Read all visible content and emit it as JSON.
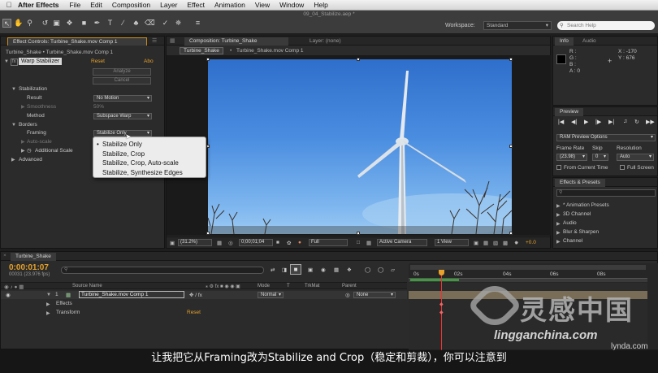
{
  "menubar": {
    "apple": "",
    "app": "After Effects",
    "items": [
      "File",
      "Edit",
      "Composition",
      "Layer",
      "Effect",
      "Animation",
      "View",
      "Window",
      "Help"
    ]
  },
  "toolbar": {
    "file_title": "09_04_Stabilize.aep *",
    "workspace_label": "Workspace:",
    "workspace_value": "Standard",
    "search_placeholder": "Search Help"
  },
  "effect_controls": {
    "tab": "Effect Controls: Turbine_Shake.mov Comp 1",
    "breadcrumb": "Turbine_Shake • Turbine_Shake.mov Comp 1",
    "fx_badge": "fx",
    "effect_name": "Warp Stabilizer",
    "reset": "Reset",
    "about": "Abo",
    "analyze": "Analyze",
    "cancel": "Cancel",
    "stabilization": "Stabilization",
    "result_label": "Result",
    "result_value": "No Motion",
    "smoothness_label": "Smoothness",
    "smoothness_value": "50%",
    "method_label": "Method",
    "method_value": "Subspace Warp",
    "borders": "Borders",
    "framing_label": "Framing",
    "framing_value": "Stabilize Only",
    "autoscale_label": "Auto-scale",
    "additional_scale": "Additional Scale",
    "advanced": "Advanced"
  },
  "framing_menu": {
    "options": [
      "Stabilize Only",
      "Stabilize, Crop",
      "Stabilize, Crop, Auto-scale",
      "Stabilize, Synthesize Edges"
    ],
    "checkmark": "•"
  },
  "composition": {
    "tab": "Composition: Turbine_Shake",
    "layer_tab": "Layer: (none)",
    "flow_tab": "Turbine_Shake",
    "breadcrumb": "Turbine_Shake.mov Comp 1",
    "zoom": "(31.2%)",
    "timecode": "0;00;01;04",
    "resolution": "Full",
    "camera": "Active Camera",
    "view": "1 View",
    "exposure": "+0.0"
  },
  "info_panel": {
    "tab_info": "Info",
    "tab_audio": "Audio",
    "r": "R :",
    "g": "G :",
    "b": "B :",
    "a": "A : 0",
    "x": "X : -170",
    "y": "Y : 676"
  },
  "preview_panel": {
    "tab": "Preview",
    "options": "RAM Preview Options",
    "frame_rate_label": "Frame Rate",
    "skip_label": "Skip",
    "resolution_label": "Resolution",
    "frame_rate_value": "(23.98)",
    "skip_value": "0",
    "resolution_value": "Auto",
    "from_current": "From Current Time",
    "full_screen": "Full Screen"
  },
  "effects_presets": {
    "tab": "Effects & Presets",
    "items": [
      "* Animation Presets",
      "3D Channel",
      "Audio",
      "Blur & Sharpen",
      "Channel"
    ]
  },
  "timeline": {
    "tab": "Turbine_Shake",
    "timecode": "0:00:01:07",
    "frame_info": "00031 (23.976 fps)",
    "search_placeholder": "",
    "col_source": "Source Name",
    "col_mode": "Mode",
    "col_t": "T",
    "col_trkmat": "TrkMat",
    "col_parent": "Parent",
    "layer_num": "1",
    "layer_name": "Turbine_Shake.mov Comp 1",
    "layer_mode": "Normal",
    "layer_parent": "None",
    "effects": "Effects",
    "transform": "Transform",
    "transform_reset": "Reset",
    "ruler": [
      "0s",
      "02s",
      "04s",
      "06s",
      "08s"
    ]
  },
  "subtitle": "让我把它从Framing改为Stabilize and Crop（稳定和剪裁），你可以注意到",
  "watermark": {
    "cn": "灵感中国",
    "url": "lingganchina.com",
    "brand": "lynda.com"
  }
}
